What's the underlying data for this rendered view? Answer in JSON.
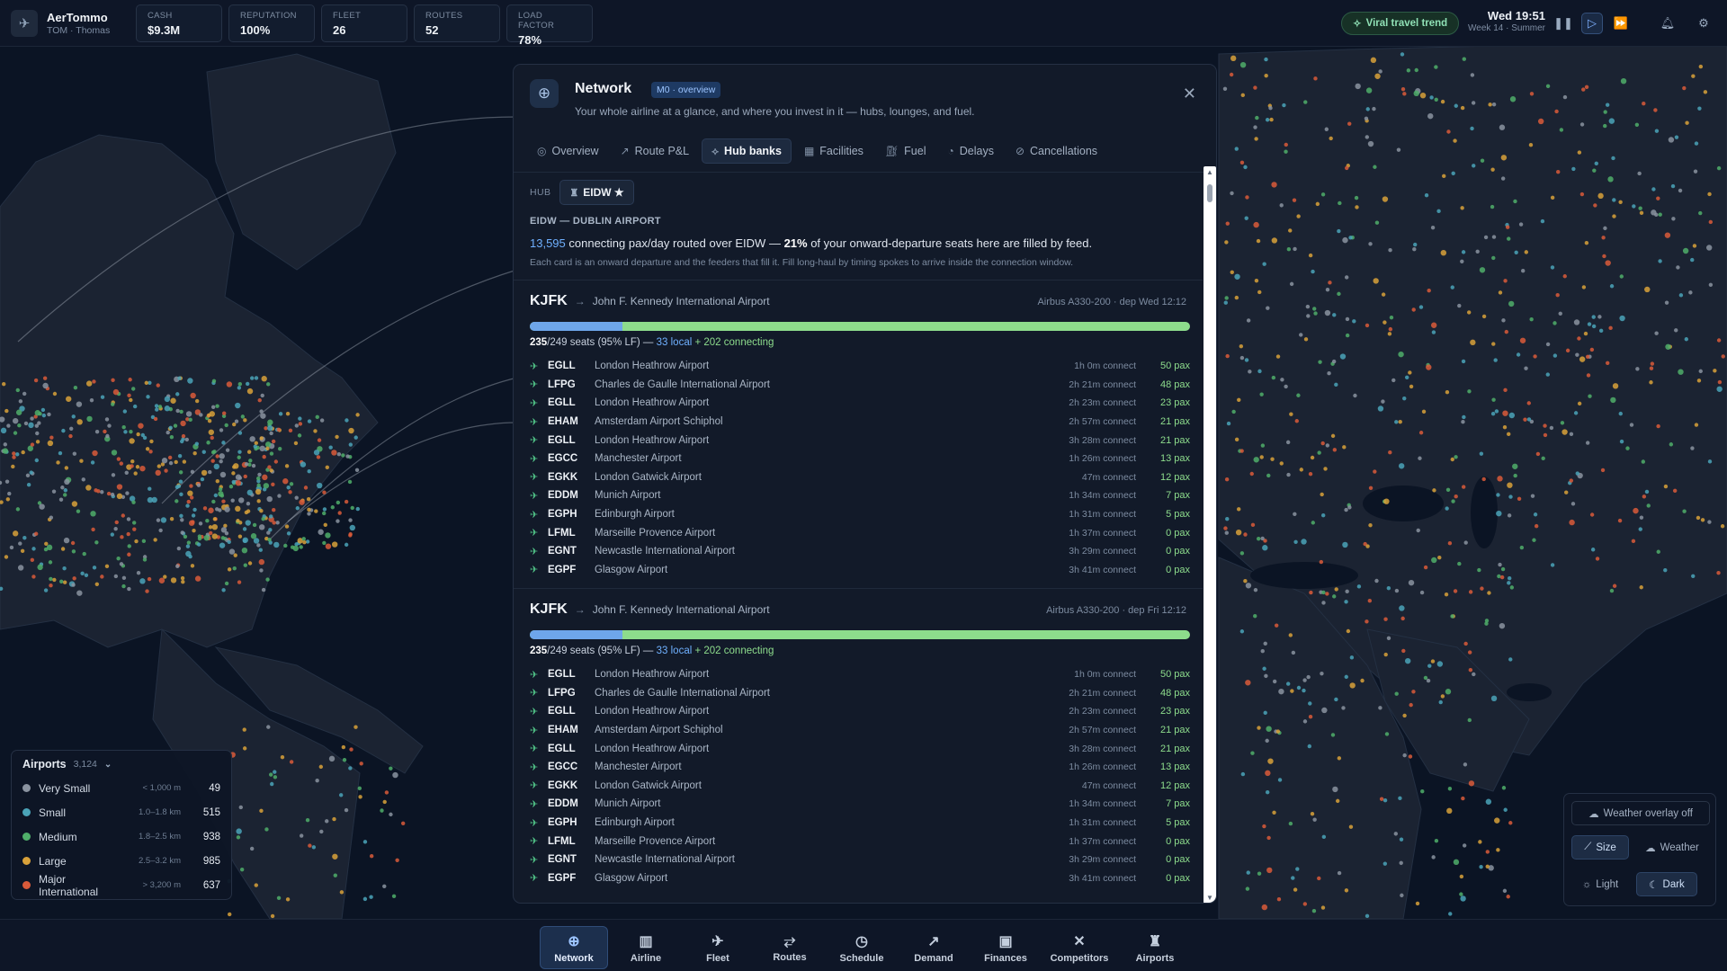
{
  "app": {
    "name": "AerTommo",
    "player": "TOM · Thomas"
  },
  "stats": [
    {
      "label": "CASH",
      "value": "$9.3M"
    },
    {
      "label": "REPUTATION",
      "value": "100%"
    },
    {
      "label": "FLEET",
      "value": "26"
    },
    {
      "label": "ROUTES",
      "value": "52"
    },
    {
      "label": "LOAD FACTOR",
      "value": "78%"
    }
  ],
  "topbar": {
    "trend_label": "Viral travel trend",
    "time": "Wed 19:51",
    "week": "Week 14 · Summer"
  },
  "panel": {
    "title": "Network",
    "badge": "M0 · overview",
    "subtitle": "Your whole airline at a glance, and where you invest in it — hubs, lounges, and fuel.",
    "tabs": [
      "Overview",
      "Route P&L",
      "Hub banks",
      "Facilities",
      "Fuel",
      "Delays",
      "Cancellations"
    ],
    "active_tab": "Hub banks",
    "hub_label": "HUB",
    "hub_chip": "EIDW ★",
    "airport_title": "EIDW — DUBLIN AIRPORT",
    "summary": {
      "pax": "13,595",
      "mid": " connecting pax/day routed over EIDW — ",
      "pct": "21%",
      "tail": " of your onward-departure seats here are filled by feed."
    },
    "note": "Each card is an onward departure and the feeders that fill it. Fill long-haul by timing spokes to arrive inside the connection window.",
    "cards": [
      {
        "dest": "KJFK",
        "dest_name": "John F. Kennedy International Airport",
        "dep": "Airbus A330-200 · dep Wed 12:12",
        "seats": "235",
        "seats_rest": "/249 seats (95% LF) —",
        "local": "33 local",
        "connecting": "+ 202 connecting",
        "local_frac": 0.14,
        "feeders": [
          {
            "code": "EGLL",
            "name": "London Heathrow Airport",
            "conn": "1h 0m connect",
            "pax": "50 pax"
          },
          {
            "code": "LFPG",
            "name": "Charles de Gaulle International Airport",
            "conn": "2h 21m connect",
            "pax": "48 pax"
          },
          {
            "code": "EGLL",
            "name": "London Heathrow Airport",
            "conn": "2h 23m connect",
            "pax": "23 pax"
          },
          {
            "code": "EHAM",
            "name": "Amsterdam Airport Schiphol",
            "conn": "2h 57m connect",
            "pax": "21 pax"
          },
          {
            "code": "EGLL",
            "name": "London Heathrow Airport",
            "conn": "3h 28m connect",
            "pax": "21 pax"
          },
          {
            "code": "EGCC",
            "name": "Manchester Airport",
            "conn": "1h 26m connect",
            "pax": "13 pax"
          },
          {
            "code": "EGKK",
            "name": "London Gatwick Airport",
            "conn": "47m connect",
            "pax": "12 pax"
          },
          {
            "code": "EDDM",
            "name": "Munich Airport",
            "conn": "1h 34m connect",
            "pax": "7 pax"
          },
          {
            "code": "EGPH",
            "name": "Edinburgh Airport",
            "conn": "1h 31m connect",
            "pax": "5 pax"
          },
          {
            "code": "LFML",
            "name": "Marseille Provence Airport",
            "conn": "1h 37m connect",
            "pax": "0 pax"
          },
          {
            "code": "EGNT",
            "name": "Newcastle International Airport",
            "conn": "3h 29m connect",
            "pax": "0 pax"
          },
          {
            "code": "EGPF",
            "name": "Glasgow Airport",
            "conn": "3h 41m connect",
            "pax": "0 pax"
          }
        ]
      },
      {
        "dest": "KJFK",
        "dest_name": "John F. Kennedy International Airport",
        "dep": "Airbus A330-200 · dep Fri 12:12",
        "seats": "235",
        "seats_rest": "/249 seats (95% LF) —",
        "local": "33 local",
        "connecting": "+ 202 connecting",
        "local_frac": 0.14,
        "feeders": [
          {
            "code": "EGLL",
            "name": "London Heathrow Airport",
            "conn": "1h 0m connect",
            "pax": "50 pax"
          },
          {
            "code": "LFPG",
            "name": "Charles de Gaulle International Airport",
            "conn": "2h 21m connect",
            "pax": "48 pax"
          },
          {
            "code": "EGLL",
            "name": "London Heathrow Airport",
            "conn": "2h 23m connect",
            "pax": "23 pax"
          },
          {
            "code": "EHAM",
            "name": "Amsterdam Airport Schiphol",
            "conn": "2h 57m connect",
            "pax": "21 pax"
          },
          {
            "code": "EGLL",
            "name": "London Heathrow Airport",
            "conn": "3h 28m connect",
            "pax": "21 pax"
          },
          {
            "code": "EGCC",
            "name": "Manchester Airport",
            "conn": "1h 26m connect",
            "pax": "13 pax"
          },
          {
            "code": "EGKK",
            "name": "London Gatwick Airport",
            "conn": "47m connect",
            "pax": "12 pax"
          },
          {
            "code": "EDDM",
            "name": "Munich Airport",
            "conn": "1h 34m connect",
            "pax": "7 pax"
          },
          {
            "code": "EGPH",
            "name": "Edinburgh Airport",
            "conn": "1h 31m connect",
            "pax": "5 pax"
          },
          {
            "code": "LFML",
            "name": "Marseille Provence Airport",
            "conn": "1h 37m connect",
            "pax": "0 pax"
          },
          {
            "code": "EGNT",
            "name": "Newcastle International Airport",
            "conn": "3h 29m connect",
            "pax": "0 pax"
          },
          {
            "code": "EGPF",
            "name": "Glasgow Airport",
            "conn": "3h 41m connect",
            "pax": "0 pax"
          }
        ]
      }
    ]
  },
  "legend": {
    "title": "Airports",
    "count": "3,124",
    "rows": [
      {
        "name": "Very Small",
        "range": "< 1,000 m",
        "count": "49",
        "color": "#8a93a0"
      },
      {
        "name": "Small",
        "range": "1.0–1.8 km",
        "count": "515",
        "color": "#4aa3b8"
      },
      {
        "name": "Medium",
        "range": "1.8–2.5 km",
        "count": "938",
        "color": "#4fae6a"
      },
      {
        "name": "Large",
        "range": "2.5–3.2 km",
        "count": "985",
        "color": "#d8a13a"
      },
      {
        "name": "Major International",
        "range": "> 3,200 m",
        "count": "637",
        "color": "#d95a3a"
      }
    ]
  },
  "controls": {
    "weather": "Weather overlay off",
    "size": "Size",
    "weather_mode": "Weather",
    "light": "Light",
    "dark": "Dark"
  },
  "nav": [
    {
      "label": "Network",
      "icon": "globe-icon"
    },
    {
      "label": "Airline",
      "icon": "building-icon"
    },
    {
      "label": "Fleet",
      "icon": "plane-icon"
    },
    {
      "label": "Routes",
      "icon": "route-icon"
    },
    {
      "label": "Schedule",
      "icon": "clock-icon"
    },
    {
      "label": "Demand",
      "icon": "trend-icon"
    },
    {
      "label": "Finances",
      "icon": "wallet-icon"
    },
    {
      "label": "Competitors",
      "icon": "crossed-planes-icon"
    },
    {
      "label": "Airports",
      "icon": "tower-icon"
    }
  ],
  "colors": {
    "accent": "#6fb0ff",
    "feed": "#8ddc8c",
    "local": "#6ea6ea",
    "bg": "#0c1526"
  }
}
